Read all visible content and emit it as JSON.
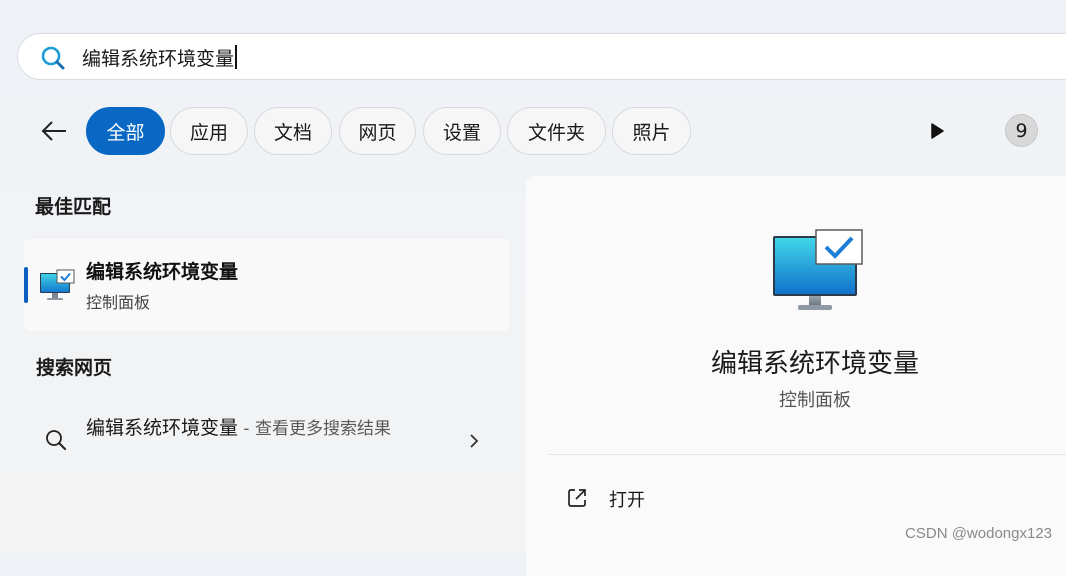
{
  "search": {
    "query": "编辑系统环境变量"
  },
  "filters": {
    "tabs": [
      {
        "label": "全部",
        "active": true
      },
      {
        "label": "应用",
        "active": false
      },
      {
        "label": "文档",
        "active": false
      },
      {
        "label": "网页",
        "active": false
      },
      {
        "label": "设置",
        "active": false
      },
      {
        "label": "文件夹",
        "active": false
      },
      {
        "label": "照片",
        "active": false
      }
    ],
    "count": "9"
  },
  "best_match": {
    "section_title": "最佳匹配",
    "title": "编辑系统环境变量",
    "subtitle": "控制面板"
  },
  "web_search": {
    "section_title": "搜索网页",
    "query": "编辑系统环境变量",
    "suffix": " - 查看更多搜索结果"
  },
  "preview": {
    "title": "编辑系统环境变量",
    "subtitle": "控制面板",
    "actions": [
      {
        "label": "打开",
        "icon": "open-external-icon"
      }
    ]
  },
  "watermark": "CSDN @wodongx123",
  "colors": {
    "accent": "#0868c4",
    "accent_bar": "#0a5fc0",
    "search_icon": "#1c9bd4"
  }
}
